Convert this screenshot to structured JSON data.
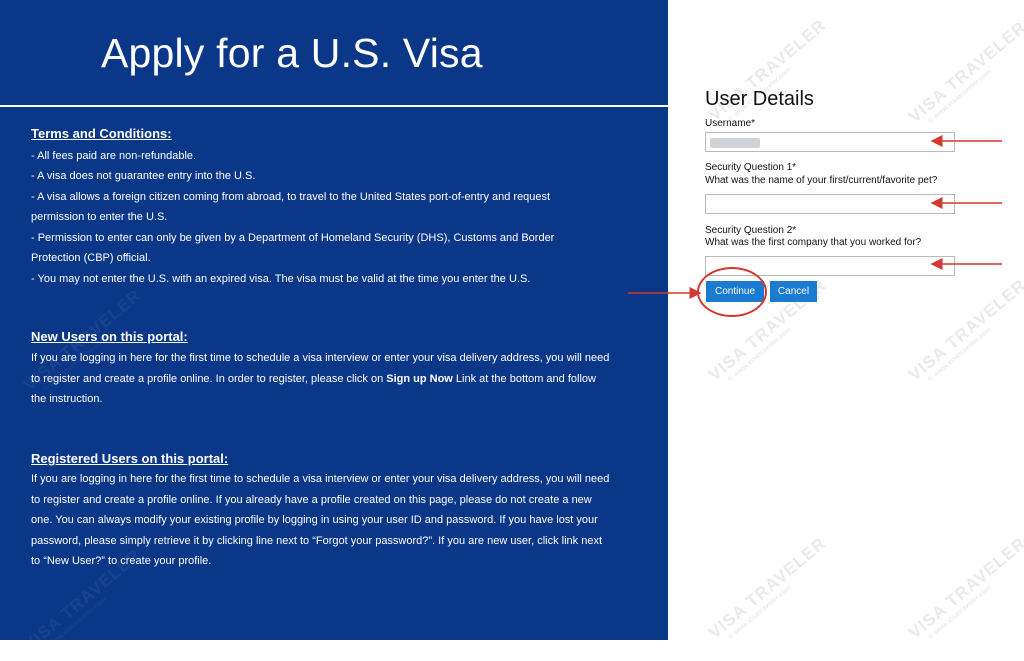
{
  "left_panel": {
    "title": "Apply for a U.S. Visa",
    "terms": {
      "heading": "Terms and Conditions:",
      "lines": [
        "- All fees paid are non-refundable.",
        "- A visa does not guarantee entry into the U.S.",
        "- A visa allows a foreign citizen coming from abroad, to travel to the United States port-of-entry and request",
        "permission to enter the U.S.",
        "- Permission to enter can only be given by a Department of Homeland Security (DHS), Customs and Border",
        "Protection (CBP) official.",
        "- You may not enter the U.S. with an expired visa. The visa must be valid at the time you enter the U.S."
      ]
    },
    "new_users": {
      "heading": "New Users on this portal:",
      "text_before": "If you are logging in here for the first time to schedule a visa interview or enter your visa delivery address, you will need to register and create a profile online. In order to register, please click on ",
      "bold": "Sign up Now",
      "text_after": " Link at the bottom and follow the instruction."
    },
    "registered_users": {
      "heading": "Registered Users on this portal:",
      "text": "If you are logging in here for the first time to schedule a visa interview or enter your visa delivery address, you will need to register and create a profile online. If you already have a profile created on this page, please do not create a new one. You can always modify your existing profile by logging in using your user ID and password. If you have lost your password, please simply retrieve it by clicking line next to “Forgot your password?”. If you are new user, click link next to “New User?” to create your profile."
    }
  },
  "user_details": {
    "title": "User Details",
    "username_label": "Username*",
    "sq1_label": "Security Question 1*",
    "sq1_question": "What was the name of your first/current/favorite pet?",
    "sq2_label": "Security Question 2*",
    "sq2_question": "What was the first company that you worked for?",
    "continue_label": "Continue",
    "cancel_label": "Cancel"
  },
  "watermark": {
    "brand": "VISA TRAVELER",
    "url": "© www.visatraveler.com"
  },
  "colors": {
    "panel_blue": "#0b3788",
    "button_blue": "#1b7bd1",
    "annotation_red": "#d33a2f"
  }
}
